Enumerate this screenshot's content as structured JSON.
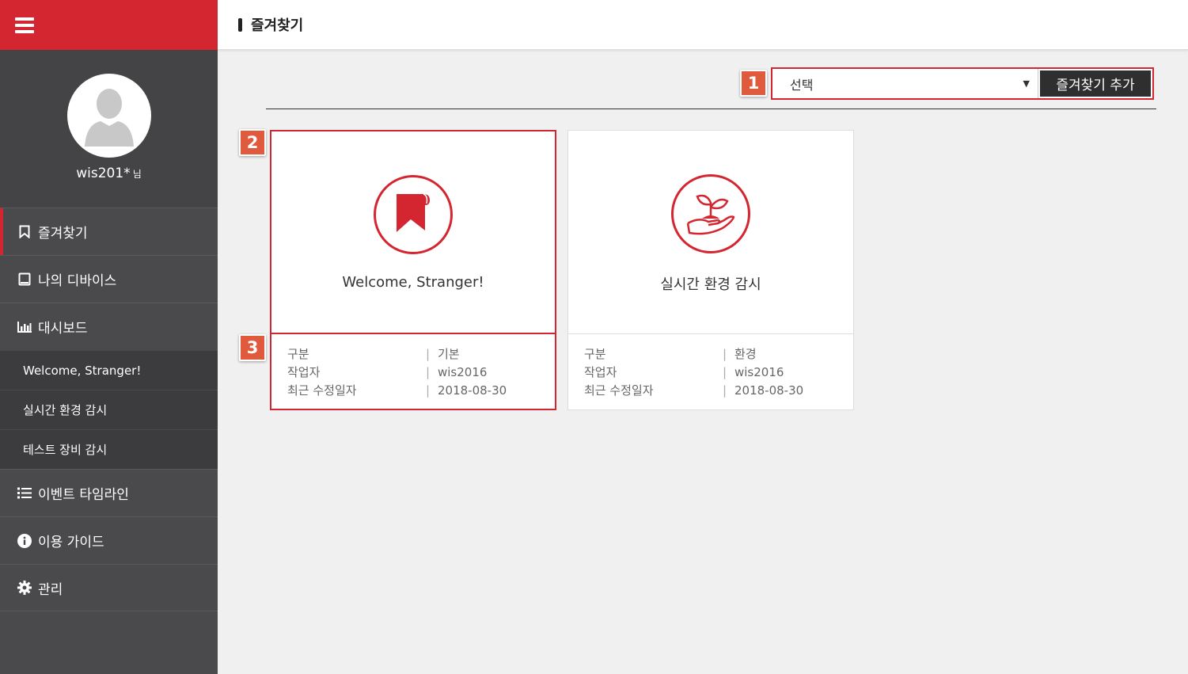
{
  "sidebar": {
    "username": "wis201*",
    "username_suffix": "님",
    "nav": [
      {
        "label": "즐겨찾기",
        "icon": "bookmark-icon"
      },
      {
        "label": "나의 디바이스",
        "icon": "tablet-icon"
      },
      {
        "label": "대시보드",
        "icon": "bar-chart-icon"
      }
    ],
    "dashboard_subitems": [
      "Welcome, Stranger!",
      "실시간 환경 감시",
      "테스트 장비 감시"
    ],
    "nav_bottom": [
      {
        "label": "이벤트 타임라인",
        "icon": "list-icon"
      },
      {
        "label": "이용 가이드",
        "icon": "info-icon"
      },
      {
        "label": "관리",
        "icon": "gear-icon"
      }
    ]
  },
  "header": {
    "title": "즐겨찾기"
  },
  "toolbar": {
    "select_value": "선택",
    "add_button": "즐겨찾기 추가"
  },
  "badges": [
    "1",
    "2",
    "3"
  ],
  "cards": [
    {
      "title": "Welcome, Stranger!",
      "icon": "bookmark-icon",
      "rows": [
        {
          "label": "구분",
          "value": "기본"
        },
        {
          "label": "작업자",
          "value": "wis2016"
        },
        {
          "label": "최근 수정일자",
          "value": "2018-08-30"
        }
      ]
    },
    {
      "title": "실시간 환경 감시",
      "icon": "sprout-hand-icon",
      "rows": [
        {
          "label": "구분",
          "value": "환경"
        },
        {
          "label": "작업자",
          "value": "wis2016"
        },
        {
          "label": "최근 수정일자",
          "value": "2018-08-30"
        }
      ]
    }
  ],
  "colors": {
    "accent": "#d42630",
    "sidebar": "#4a4a4c",
    "badge": "#e05a3e"
  }
}
